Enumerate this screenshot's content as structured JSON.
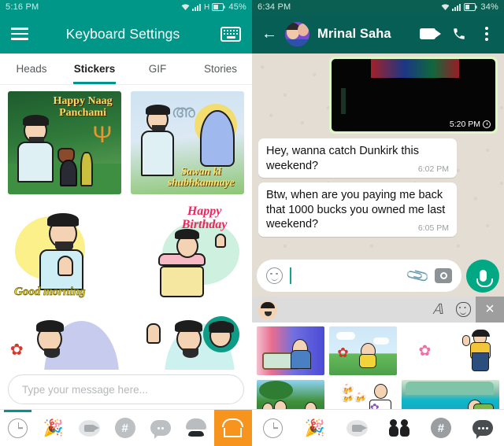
{
  "left_screen": {
    "status_bar": {
      "time": "5:16 PM",
      "network_type": "H",
      "battery_percent": "45%",
      "icons": [
        "wifi-icon",
        "signal-icon",
        "battery-icon"
      ]
    },
    "app_bar": {
      "menu_icon": "hamburger-menu-icon",
      "title": "Keyboard Settings",
      "keyboard_icon": "keyboard-icon"
    },
    "tabs": [
      {
        "label": "Heads",
        "active": false
      },
      {
        "label": "Stickers",
        "active": true
      },
      {
        "label": "GIF",
        "active": false
      },
      {
        "label": "Stories",
        "active": false
      }
    ],
    "stickers": [
      {
        "caption": "Happy Naag Panchami",
        "name": "sticker-naag-panchami"
      },
      {
        "caption": "Sawan ki shubhkamnaye",
        "name": "sticker-sawan"
      },
      {
        "caption": "Good morning",
        "name": "sticker-good-morning"
      },
      {
        "caption": "Happy Birthday",
        "name": "sticker-happy-birthday"
      },
      {
        "caption": "",
        "name": "sticker-flowers-partial"
      },
      {
        "caption": "",
        "name": "sticker-thumbsup-partial"
      }
    ],
    "message_input": {
      "placeholder": "Type your message here...",
      "value": ""
    },
    "nav_items": [
      {
        "icon": "recent-clock-icon",
        "active": true
      },
      {
        "icon": "party-popper-icon",
        "active": false
      },
      {
        "icon": "video-camera-icon",
        "active": false
      },
      {
        "icon": "hashtag-icon",
        "active": false
      },
      {
        "icon": "speech-bubble-icon",
        "active": false
      },
      {
        "icon": "moustache-avatar-icon",
        "active": false
      },
      {
        "icon": "sticker-store-icon",
        "active": false
      }
    ]
  },
  "right_screen": {
    "status_bar": {
      "time": "6:34 PM",
      "battery_percent": "34%",
      "icons": [
        "wifi-icon",
        "signal-icon",
        "battery-icon"
      ]
    },
    "app_bar": {
      "back_icon": "back-arrow-icon",
      "contact_name": "Mrinal Saha",
      "video_call_icon": "video-call-icon",
      "voice_call_icon": "phone-call-icon",
      "overflow_icon": "more-vertical-icon"
    },
    "messages": [
      {
        "type": "outgoing-video",
        "time": "5:20 PM",
        "status_icon": "clock-pending-icon",
        "text": ""
      },
      {
        "type": "incoming",
        "text": "Hey, wanna catch Dunkirk this weekend?",
        "time": "6:02 PM"
      },
      {
        "type": "incoming",
        "text": "Btw, when are you paying me back that 1000 bucks you owned me last weekend?",
        "time": "6:05 PM"
      }
    ],
    "message_input": {
      "placeholder": "",
      "value": "",
      "emoji_icon": "emoji-smile-icon",
      "attach_icon": "paperclip-icon",
      "camera_icon": "camera-icon",
      "mic_icon": "microphone-icon"
    },
    "sticker_toolbar": {
      "avatar_icon": "bitmoji-avatar-icon",
      "text_icon": "text-style-icon",
      "mask_icon": "mask-emoji-icon",
      "close_icon": "close-icon"
    },
    "sticker_grid": [
      {
        "name": "sticker-bedroom"
      },
      {
        "name": "sticker-flower-bouquet"
      },
      {
        "name": "sticker-small-flowers"
      },
      {
        "name": "sticker-waving"
      },
      {
        "name": "sticker-swing-friends"
      },
      {
        "name": "sticker-champagne-tower"
      },
      {
        "name": "sticker-groom-bouquet"
      },
      {
        "name": "sticker-lakeside"
      }
    ],
    "nav_items": [
      {
        "icon": "recent-clock-icon",
        "active": true
      },
      {
        "icon": "party-popper-icon",
        "active": false
      },
      {
        "icon": "video-camera-icon",
        "active": false
      },
      {
        "icon": "friends-icon",
        "active": false
      },
      {
        "icon": "hashtag-icon",
        "active": false
      },
      {
        "icon": "speech-bubble-icon",
        "active": false
      }
    ]
  },
  "colors": {
    "teal_primary": "#009688",
    "whatsapp_header": "#075e54",
    "whatsapp_status": "#0b5e52",
    "outgoing_bubble": "#dcf8c6",
    "chat_background": "#e4ddd4",
    "accent_orange": "#f7941d",
    "mic_green": "#00a884"
  }
}
